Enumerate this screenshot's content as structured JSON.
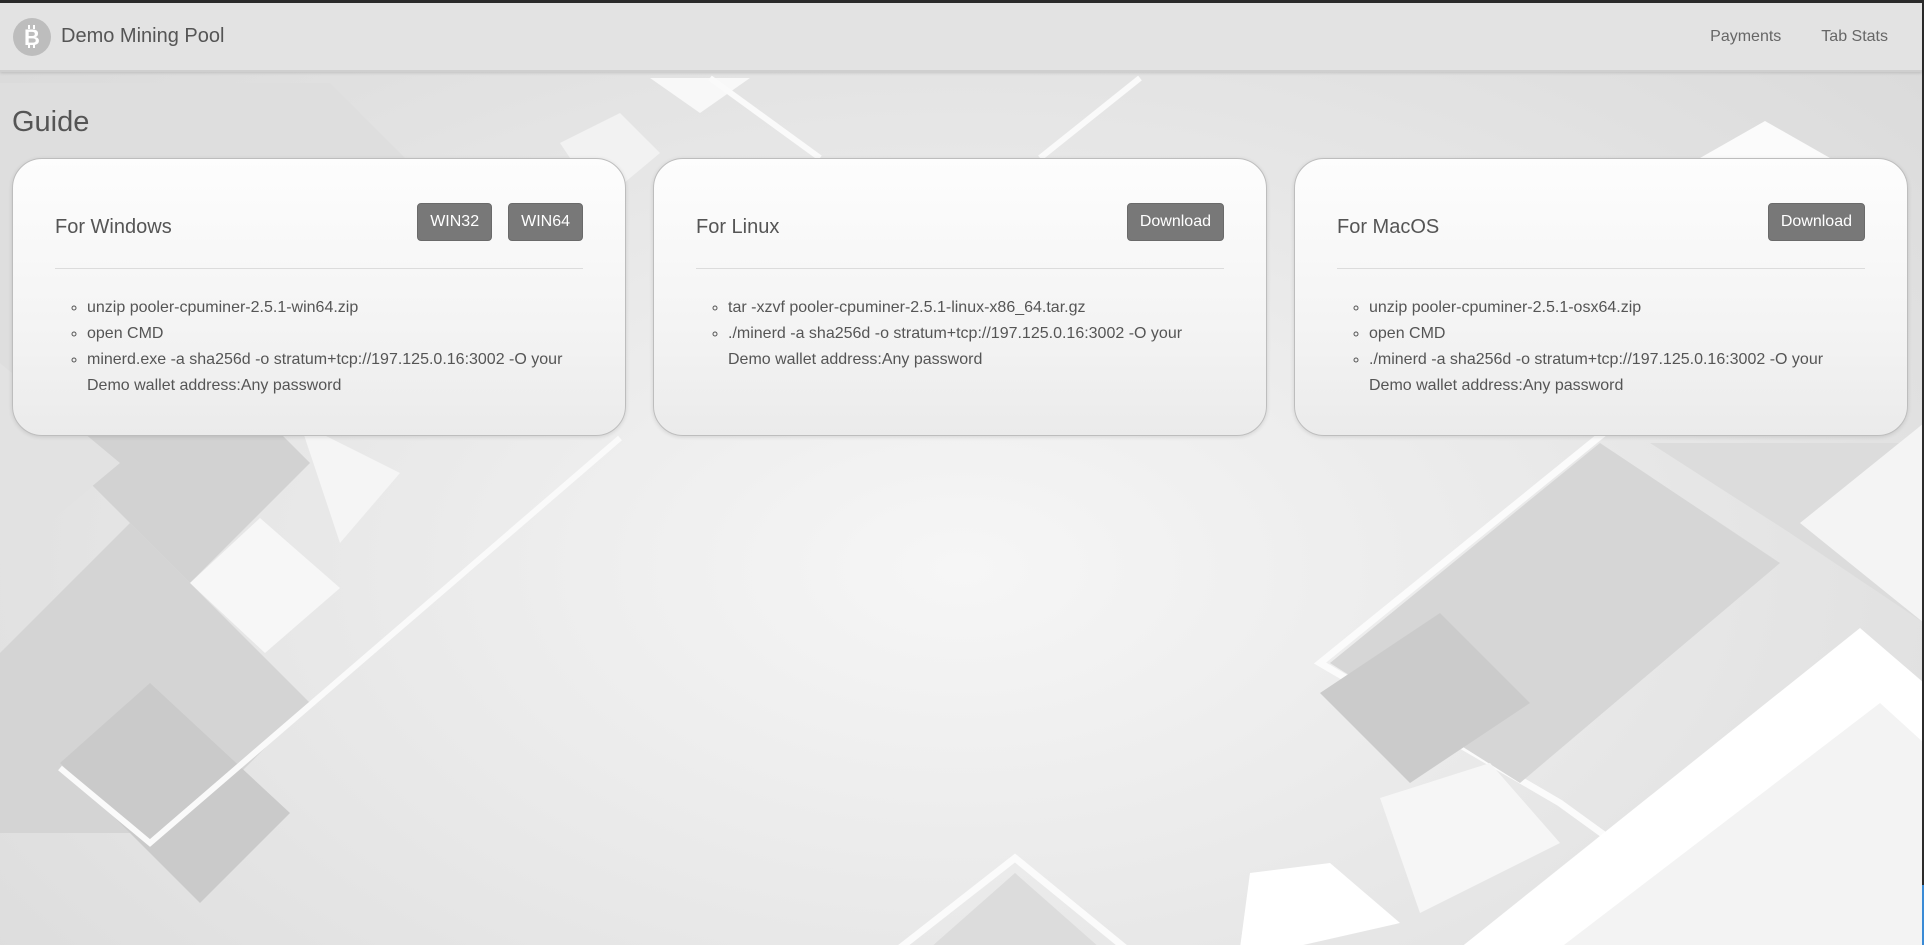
{
  "header": {
    "brand_title": "Demo Mining Pool",
    "logo_icon": "bitcoin-icon",
    "nav": [
      {
        "label": "Payments"
      },
      {
        "label": "Tab Stats"
      }
    ]
  },
  "main": {
    "title": "Guide",
    "cards": [
      {
        "title": "For Windows",
        "buttons": [
          "WIN32",
          "WIN64"
        ],
        "steps": [
          "unzip pooler-cpuminer-2.5.1-win64.zip",
          "open CMD",
          "minerd.exe -a sha256d -o stratum+tcp://197.125.0.16:3002 -O your Demo wallet address:Any password"
        ]
      },
      {
        "title": "For Linux",
        "buttons": [
          "Download"
        ],
        "steps": [
          "tar -xzvf pooler-cpuminer-2.5.1-linux-x86_64.tar.gz",
          "./minerd -a sha256d -o stratum+tcp://197.125.0.16:3002 -O your Demo wallet address:Any password"
        ]
      },
      {
        "title": "For MacOS",
        "buttons": [
          "Download"
        ],
        "steps": [
          "unzip pooler-cpuminer-2.5.1-osx64.zip",
          "open CMD",
          "./minerd -a sha256d -o stratum+tcp://197.125.0.16:3002 -O your Demo wallet address:Any password"
        ]
      }
    ]
  },
  "colors": {
    "header_bg": "#e3e3e3",
    "button_bg": "#787878",
    "text": "#555555",
    "logo_bg": "#bdbdbd"
  }
}
